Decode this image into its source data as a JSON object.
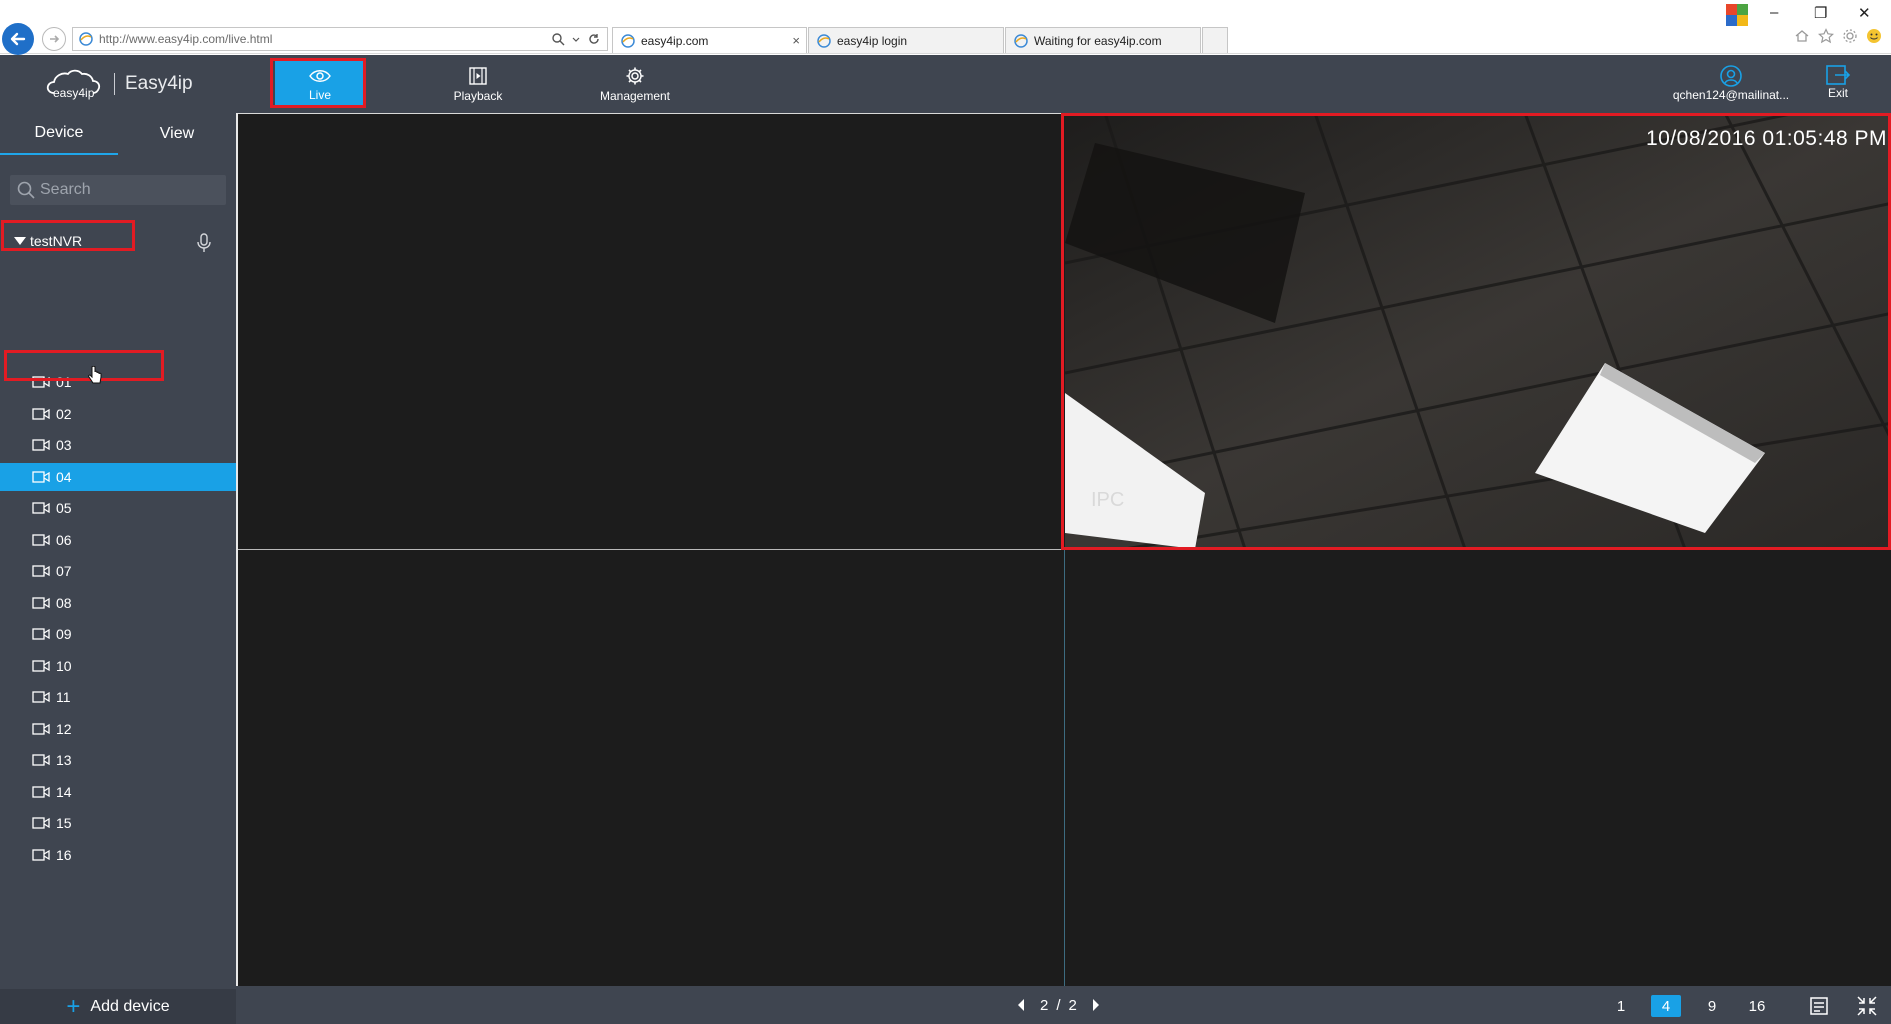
{
  "browser": {
    "url": "http://www.easy4ip.com/live.html",
    "tabs": [
      {
        "label": "easy4ip.com",
        "active": true
      },
      {
        "label": "easy4ip login",
        "active": false
      },
      {
        "label": "Waiting for easy4ip.com",
        "active": false
      }
    ],
    "tab_close": "×",
    "window_controls": {
      "minimize": "–",
      "restore": "❐",
      "close": "✕"
    }
  },
  "app": {
    "logo_text": "easy4ip",
    "brand": "Easy4ip",
    "nav": [
      {
        "label": "Live",
        "active": true,
        "icon": "eye-icon"
      },
      {
        "label": "Playback",
        "active": false,
        "icon": "film-icon"
      },
      {
        "label": "Management",
        "active": false,
        "icon": "gear-icon"
      }
    ],
    "user": "qchen124@mailinat...",
    "exit_label": "Exit"
  },
  "sidebar": {
    "tabs": [
      {
        "label": "Device",
        "active": true
      },
      {
        "label": "View",
        "active": false
      }
    ],
    "search_placeholder": "Search",
    "device_name": "testNVR",
    "channels": [
      "01",
      "02",
      "03",
      "04",
      "05",
      "06",
      "07",
      "08",
      "09",
      "10",
      "11",
      "12",
      "13",
      "14",
      "15",
      "16"
    ],
    "selected_channel": "04",
    "add_device_label": "Add device"
  },
  "video": {
    "timestamp": "10/08/2016 01:05:48 PM",
    "camera_label": "IPC"
  },
  "bottom": {
    "page_current": "2",
    "page_sep": "/",
    "page_total": "2",
    "layouts": [
      "1",
      "4",
      "9",
      "16"
    ],
    "active_layout": "4"
  },
  "colors": {
    "accent": "#19a1e6",
    "header_bg": "#3f4550",
    "highlight_red": "#e21b23",
    "video_bg": "#1c1c1c"
  }
}
